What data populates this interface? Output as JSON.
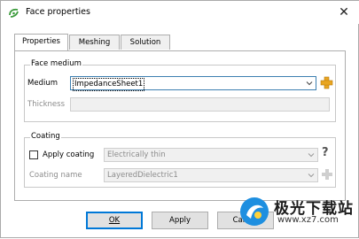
{
  "window": {
    "title": "Face properties",
    "close_glyph": "✕"
  },
  "tabs": [
    {
      "label": "Properties",
      "active": true
    },
    {
      "label": "Meshing",
      "active": false
    },
    {
      "label": "Solution",
      "active": false
    }
  ],
  "face_medium": {
    "group_title": "Face medium",
    "medium_label": "Medium",
    "medium_value": "ImpedanceSheet1",
    "add_icon": "plus-icon",
    "thickness_label": "Thickness",
    "thickness_value": ""
  },
  "coating": {
    "group_title": "Coating",
    "apply_label": "Apply coating",
    "apply_checked": false,
    "apply_value": "Electrically thin",
    "help_glyph": "?",
    "name_label": "Coating name",
    "name_value": "LayeredDielectric1"
  },
  "buttons": {
    "ok": "OK",
    "apply": "Apply",
    "cancel": "Cancel"
  },
  "watermark": {
    "title": "极光下载站",
    "url": "www.xz7.com"
  }
}
